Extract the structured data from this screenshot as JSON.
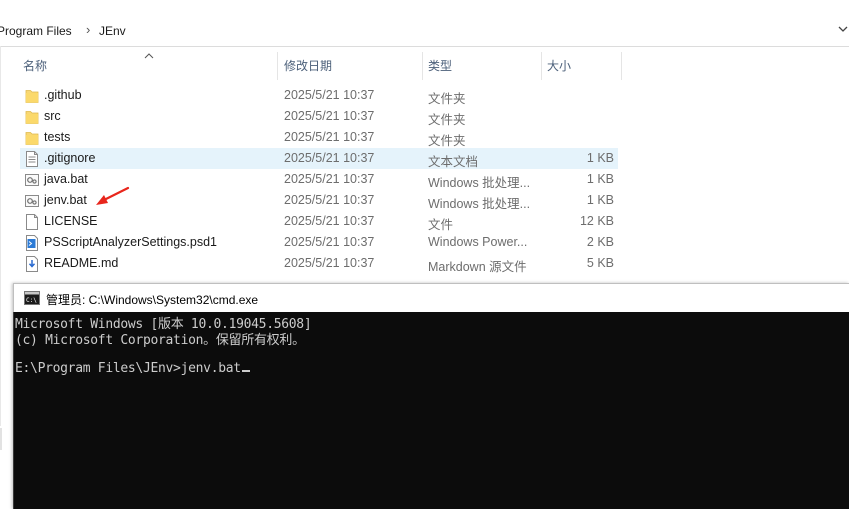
{
  "explorer": {
    "breadcrumb": [
      "Program Files",
      "JEnv"
    ],
    "columns": {
      "name": "名称",
      "date": "修改日期",
      "type": "类型",
      "size": "大小"
    },
    "files": [
      {
        "name": ".github",
        "date": "2025/5/21 10:37",
        "type": "文件夹",
        "size": "",
        "icon": "folder-icon"
      },
      {
        "name": "src",
        "date": "2025/5/21 10:37",
        "type": "文件夹",
        "size": "",
        "icon": "folder-icon"
      },
      {
        "name": "tests",
        "date": "2025/5/21 10:37",
        "type": "文件夹",
        "size": "",
        "icon": "folder-icon"
      },
      {
        "name": ".gitignore",
        "date": "2025/5/21 10:37",
        "type": "文本文档",
        "size": "1 KB",
        "icon": "text-file-icon",
        "selected": true
      },
      {
        "name": "java.bat",
        "date": "2025/5/21 10:37",
        "type": "Windows 批处理...",
        "size": "1 KB",
        "icon": "batch-file-icon"
      },
      {
        "name": "jenv.bat",
        "date": "2025/5/21 10:37",
        "type": "Windows 批处理...",
        "size": "1 KB",
        "icon": "batch-file-icon"
      },
      {
        "name": "LICENSE",
        "date": "2025/5/21 10:37",
        "type": "文件",
        "size": "12 KB",
        "icon": "blank-file-icon"
      },
      {
        "name": "PSScriptAnalyzerSettings.psd1",
        "date": "2025/5/21 10:37",
        "type": "Windows Power...",
        "size": "2 KB",
        "icon": "powershell-file-icon"
      },
      {
        "name": "README.md",
        "date": "2025/5/21 10:37",
        "type": "Markdown 源文件",
        "size": "5 KB",
        "icon": "markdown-file-icon"
      }
    ],
    "annotation_color": "#e8261c"
  },
  "cmd": {
    "title": "管理员: C:\\Windows\\System32\\cmd.exe",
    "lines": [
      "Microsoft Windows [版本 10.0.19045.5608]",
      "(c) Microsoft Corporation。保留所有权利。",
      "",
      "E:\\Program Files\\JEnv>jenv.bat"
    ]
  }
}
